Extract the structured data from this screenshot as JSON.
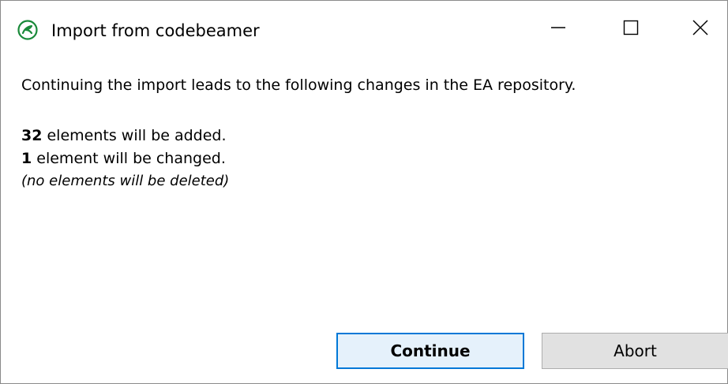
{
  "window": {
    "title": "Import from codebeamer"
  },
  "icons": {
    "app": "codebeamer-logo-icon",
    "minimize": "minimize-icon",
    "maximize": "maximize-icon",
    "close": "close-icon"
  },
  "message": {
    "intro": "Continuing the import leads to the following changes in the EA repository.",
    "added_count": "32",
    "added_text": " elements will be added.",
    "changed_count": "1",
    "changed_text": " element will be changed.",
    "deleted_text": "(no elements will be deleted)"
  },
  "buttons": {
    "continue_label": "Continue",
    "abort_label": "Abort"
  },
  "colors": {
    "accent": "#0078d7",
    "logo_green": "#1a8a3a"
  }
}
